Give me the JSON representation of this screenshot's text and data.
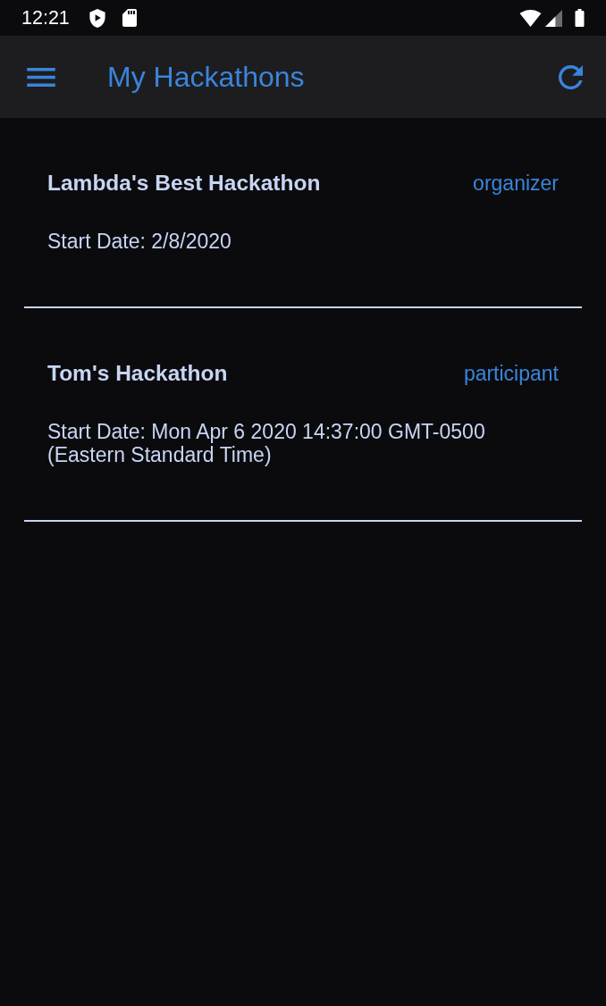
{
  "status_bar": {
    "time": "12:21"
  },
  "app_bar": {
    "title": "My Hackathons"
  },
  "hackathons": [
    {
      "name": "Lambda's Best Hackathon",
      "role": "organizer",
      "start_date": "Start Date: 2/8/2020"
    },
    {
      "name": "Tom's Hackathon",
      "role": "participant",
      "start_date": "Start Date: Mon Apr 6 2020 14:37:00 GMT-0500 (Eastern Standard Time)"
    }
  ]
}
